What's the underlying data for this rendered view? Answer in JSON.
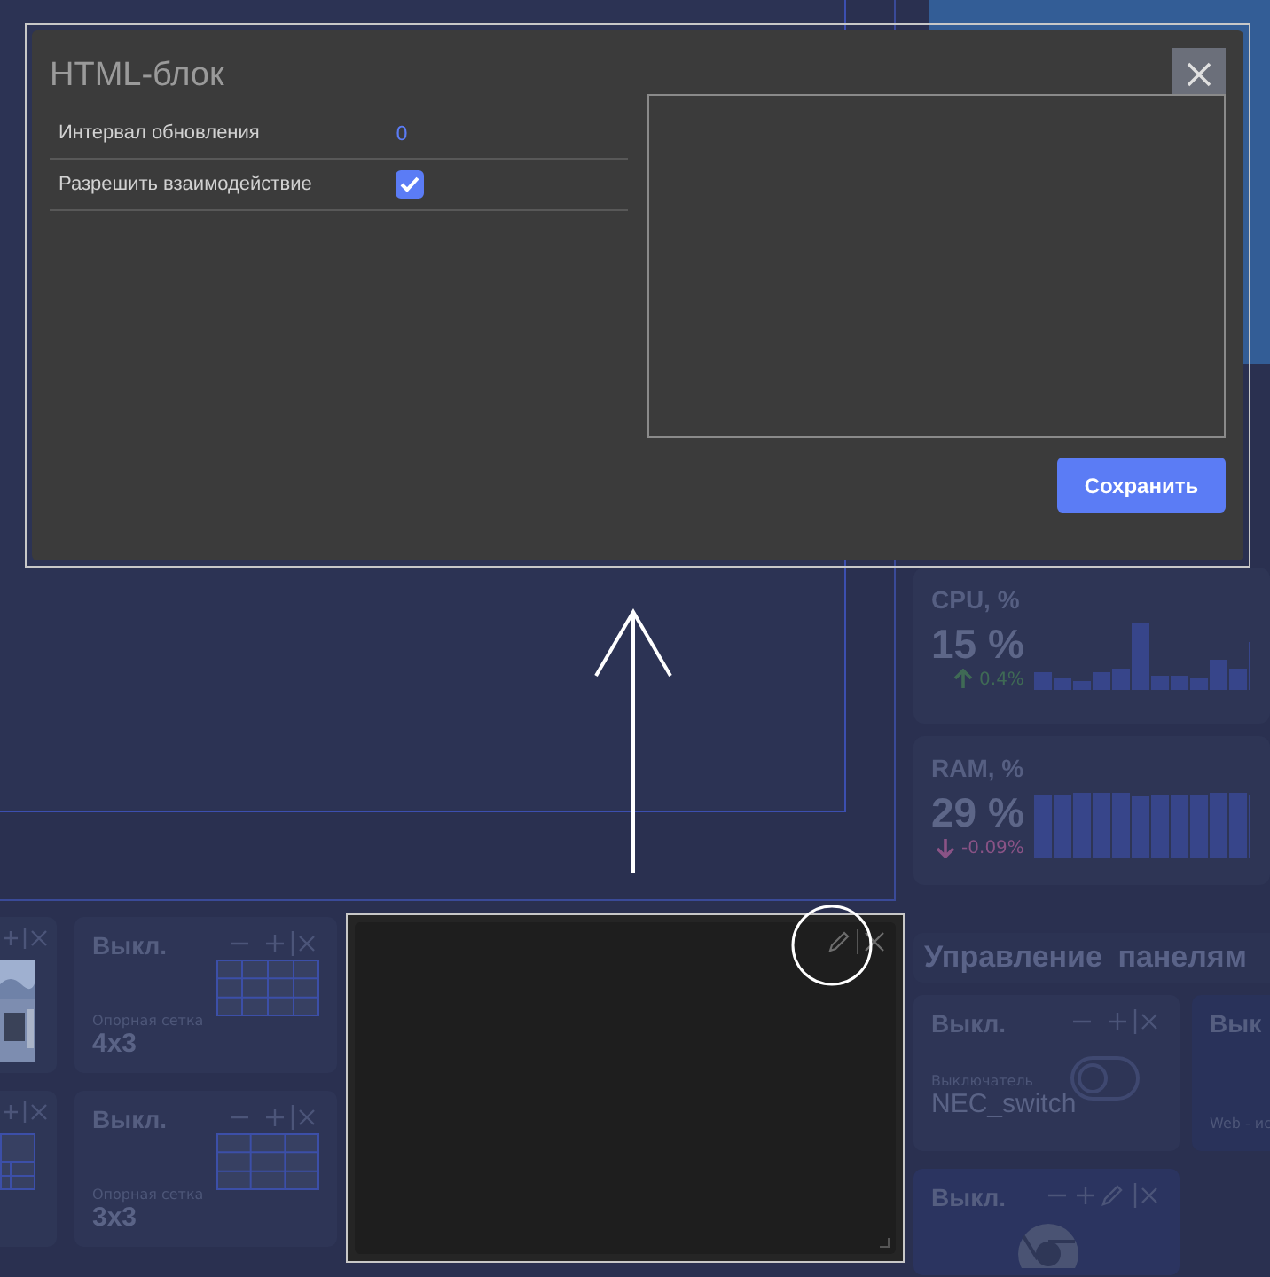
{
  "dialog": {
    "title": "HTML-блок",
    "fields": [
      {
        "kind": "number",
        "label": "Интервал обновления",
        "value": "0"
      },
      {
        "kind": "checkbox",
        "label": "Разрешить взаимодействие",
        "checked": true
      }
    ],
    "save_button": "Сохранить"
  },
  "metrics": [
    {
      "title": "CPU, %",
      "value": "15 %",
      "change": "0.4%",
      "rising": true
    },
    {
      "title": "RAM, %",
      "value": "29 %",
      "change": "-0.09%",
      "rising": false
    }
  ],
  "grid_tiles": [
    {
      "kind": "grid_4x3",
      "status": "Выкл.",
      "type_label": "Опорная сетка",
      "name": "4x3"
    },
    {
      "kind": "grid_3x3",
      "status": "Выкл.",
      "type_label": "Опорная сетка",
      "name": "3x3"
    }
  ],
  "panel_section": {
    "title": "Управление панелям",
    "tiles": [
      {
        "kind": "switch",
        "status": "Выкл.",
        "type_label": "Выключатель",
        "name": "NEC_switch"
      },
      {
        "kind": "web",
        "status": "Вык",
        "type_label": "Web - ис"
      },
      {
        "kind": "browser",
        "status": "Выкл."
      }
    ]
  }
}
